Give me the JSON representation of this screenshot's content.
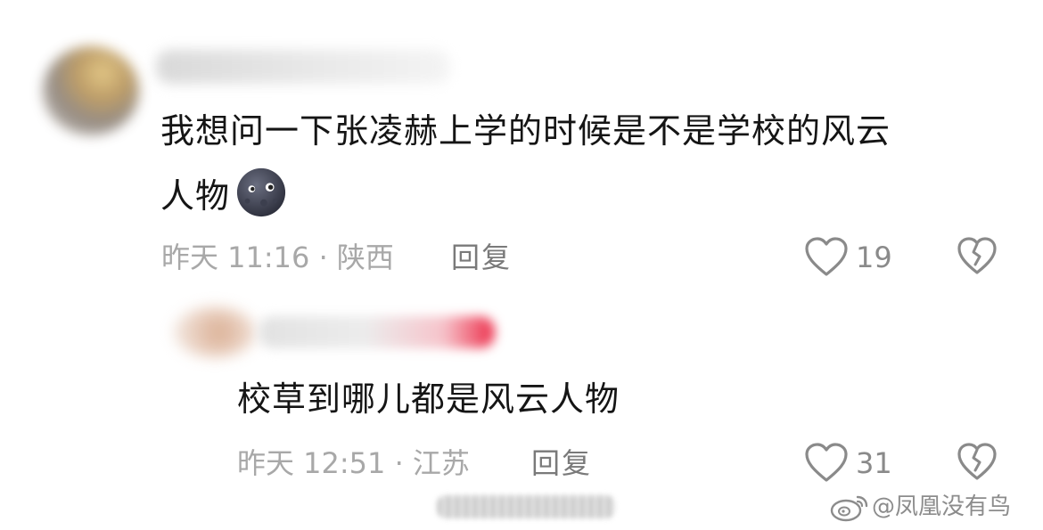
{
  "comment": {
    "text_line1": "我想问一下张凌赫上学的时候是不是学校的风云",
    "text_line2": "人物",
    "emoji_icon": "new-moon-face-icon",
    "time_location": "昨天 11:16 · 陕西",
    "reply_label": "回复",
    "like_count": "19"
  },
  "reply": {
    "text": "校草到哪儿都是风云人物",
    "time_location": "昨天 12:51 · 江苏",
    "reply_label": "回复",
    "like_count": "31"
  },
  "watermark": {
    "text": "@凤凰没有鸟",
    "icon": "weibo-logo-icon"
  },
  "colors": {
    "text": "#151515",
    "meta": "#a8a8a8",
    "icon": "#8a8a8a"
  }
}
